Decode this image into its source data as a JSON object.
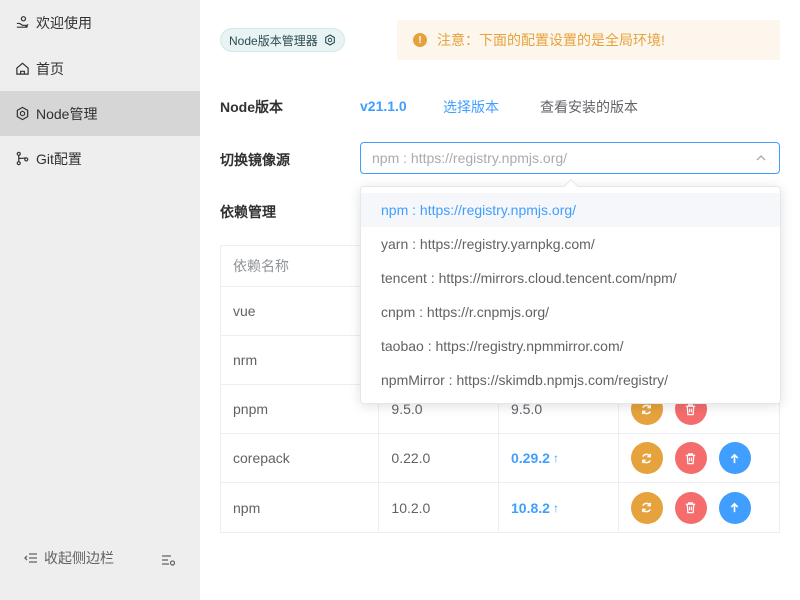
{
  "sidebar": {
    "items": [
      {
        "label": "欢迎使用",
        "icon": "hand-icon"
      },
      {
        "label": "首页",
        "icon": "home-icon"
      },
      {
        "label": "Node管理",
        "icon": "node-icon"
      },
      {
        "label": "Git配置",
        "icon": "git-icon"
      }
    ],
    "active_index": 2,
    "collapse_label": "收起侧边栏"
  },
  "header": {
    "tag_label": "Node版本管理器",
    "alert_text": "注意：下面的配置设置的是全局环境!"
  },
  "node": {
    "label": "Node版本",
    "version": "v21.1.0",
    "select_version": "选择版本",
    "view_installed": "查看安装的版本"
  },
  "mirror": {
    "label": "切换镜像源",
    "placeholder": "npm : https://registry.npmjs.org/",
    "options": [
      "npm : https://registry.npmjs.org/",
      "yarn : https://registry.yarnpkg.com/",
      "tencent : https://mirrors.cloud.tencent.com/npm/",
      "cnpm : https://r.cnpmjs.org/",
      "taobao : https://registry.npmmirror.com/",
      "npmMirror : https://skimdb.npmjs.com/registry/"
    ],
    "selected_index": 0
  },
  "deps": {
    "label": "依赖管理",
    "columns": [
      "依赖名称",
      "",
      "",
      ""
    ],
    "rows": [
      {
        "name": "vue",
        "current": "",
        "latest": "",
        "upgradable": false
      },
      {
        "name": "nrm",
        "current": "",
        "latest": "",
        "upgradable": false
      },
      {
        "name": "pnpm",
        "current": "9.5.0",
        "latest": "9.5.0",
        "upgradable": false
      },
      {
        "name": "corepack",
        "current": "0.22.0",
        "latest": "0.29.2",
        "upgradable": true
      },
      {
        "name": "npm",
        "current": "10.2.0",
        "latest": "10.8.2",
        "upgradable": true
      }
    ]
  },
  "colors": {
    "primary": "#409eff",
    "warning": "#e6a23c",
    "danger": "#f56c6c",
    "sidebar_bg": "#eeeeee",
    "sidebar_active": "#d6d6d6"
  }
}
